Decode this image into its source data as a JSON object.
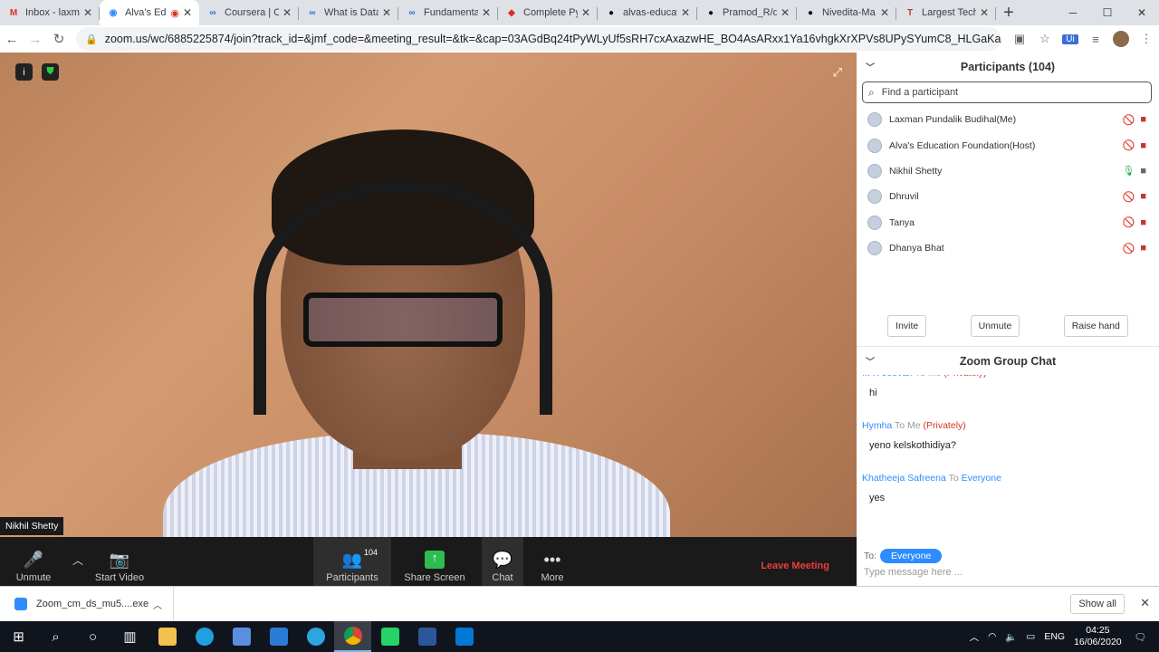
{
  "browser": {
    "tabs": [
      {
        "title": "Inbox - laxm",
        "favicon": "gmail-icon",
        "active": false
      },
      {
        "title": "Alva's Ed",
        "favicon": "zoom-icon",
        "active": true
      },
      {
        "title": "Coursera | O",
        "favicon": "link-icon",
        "active": false
      },
      {
        "title": "What is Data",
        "favicon": "link-icon",
        "active": false
      },
      {
        "title": "Fundamenta",
        "favicon": "link-icon",
        "active": false
      },
      {
        "title": "Complete Py",
        "favicon": "python-icon",
        "active": false
      },
      {
        "title": "alvas-educat",
        "favicon": "github-icon",
        "active": false
      },
      {
        "title": "Pramod_R/d",
        "favicon": "github-icon",
        "active": false
      },
      {
        "title": "Nivedita-Ma",
        "favicon": "github-icon",
        "active": false
      },
      {
        "title": "Largest Tech",
        "favicon": "tg-icon",
        "active": false
      }
    ],
    "url": "zoom.us/wc/6885225874/join?track_id=&jmf_code=&meeting_result=&tk=&cap=03AGdBq24tPyWLyUf5sRH7cxAxazwHE_BO4AsARxx1Ya16vhgkXrXPVs8UPySYumC8_HLGaKaWtKNGAVGU..."
  },
  "video": {
    "speaker_name": "Nikhil Shetty"
  },
  "controls": {
    "unmute": "Unmute",
    "start_video": "Start Video",
    "participants": "Participants",
    "participant_count": "104",
    "share_screen": "Share Screen",
    "chat": "Chat",
    "more": "More",
    "leave": "Leave Meeting"
  },
  "participants_panel": {
    "title": "Participants (104)",
    "search_placeholder": "Find a participant",
    "people": [
      {
        "name": "Laxman Pundalik Budihal(Me)",
        "mic": "muted",
        "video": "off"
      },
      {
        "name": "Alva's Education Foundation(Host)",
        "mic": "muted",
        "video": "off"
      },
      {
        "name": "Nikhil Shetty",
        "mic": "on",
        "video": "on"
      },
      {
        "name": "Dhruvil",
        "mic": "muted",
        "video": "off"
      },
      {
        "name": "Tanya",
        "mic": "muted",
        "video": "off"
      },
      {
        "name": "Dhanya Bhat",
        "mic": "muted",
        "video": "off"
      }
    ],
    "invite": "Invite",
    "unmute": "Unmute",
    "raise_hand": "Raise hand"
  },
  "chat": {
    "title": "Zoom Group Chat",
    "messages": [
      {
        "from": "M R Jeevan",
        "to": "To Me",
        "privately": "(Privately)",
        "text": "hi"
      },
      {
        "from": "Hymha",
        "to": "To Me",
        "privately": "(Privately)",
        "text": "yeno kelskothidiya?"
      },
      {
        "from": "Khatheeja Safreena",
        "to": "To",
        "to_target": "Everyone",
        "text": "yes"
      }
    ],
    "to_label": "To:",
    "to_value": "Everyone",
    "input_placeholder": "Type message here ..."
  },
  "downloads": {
    "file": "Zoom_cm_ds_mu5....exe",
    "show_all": "Show all"
  },
  "taskbar": {
    "lang": "ENG",
    "time": "04:25",
    "date": "16/06/2020"
  }
}
